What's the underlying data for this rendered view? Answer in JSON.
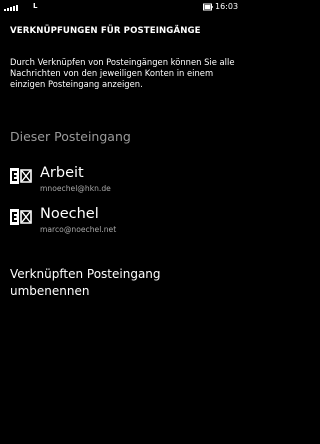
{
  "status_bar": {
    "network": "L",
    "time": "16:03",
    "signal_icon": "signal-strength-icon",
    "battery_icon": "battery-icon"
  },
  "header": {
    "title": "VERKNÜPFUNGEN FÜR POSTEINGÄNGE"
  },
  "description": "Durch Verknüpfen von Posteingängen können Sie alle Nachrichten von den jeweiligen Konten in einem einzigen Posteingang anzeigen.",
  "section": {
    "title": "Dieser Posteingang"
  },
  "accounts": [
    {
      "name": "Arbeit",
      "email": "mnoechel@hkn.de",
      "icon": "exchange-icon"
    },
    {
      "name": "Noechel",
      "email": "marco@noechel.net",
      "icon": "exchange-icon"
    }
  ],
  "rename_action": {
    "label": "Verknüpften Posteingang umbenennen"
  },
  "colors": {
    "background": "#000000",
    "text": "#ffffff",
    "secondary_text": "#9a9a9a"
  }
}
